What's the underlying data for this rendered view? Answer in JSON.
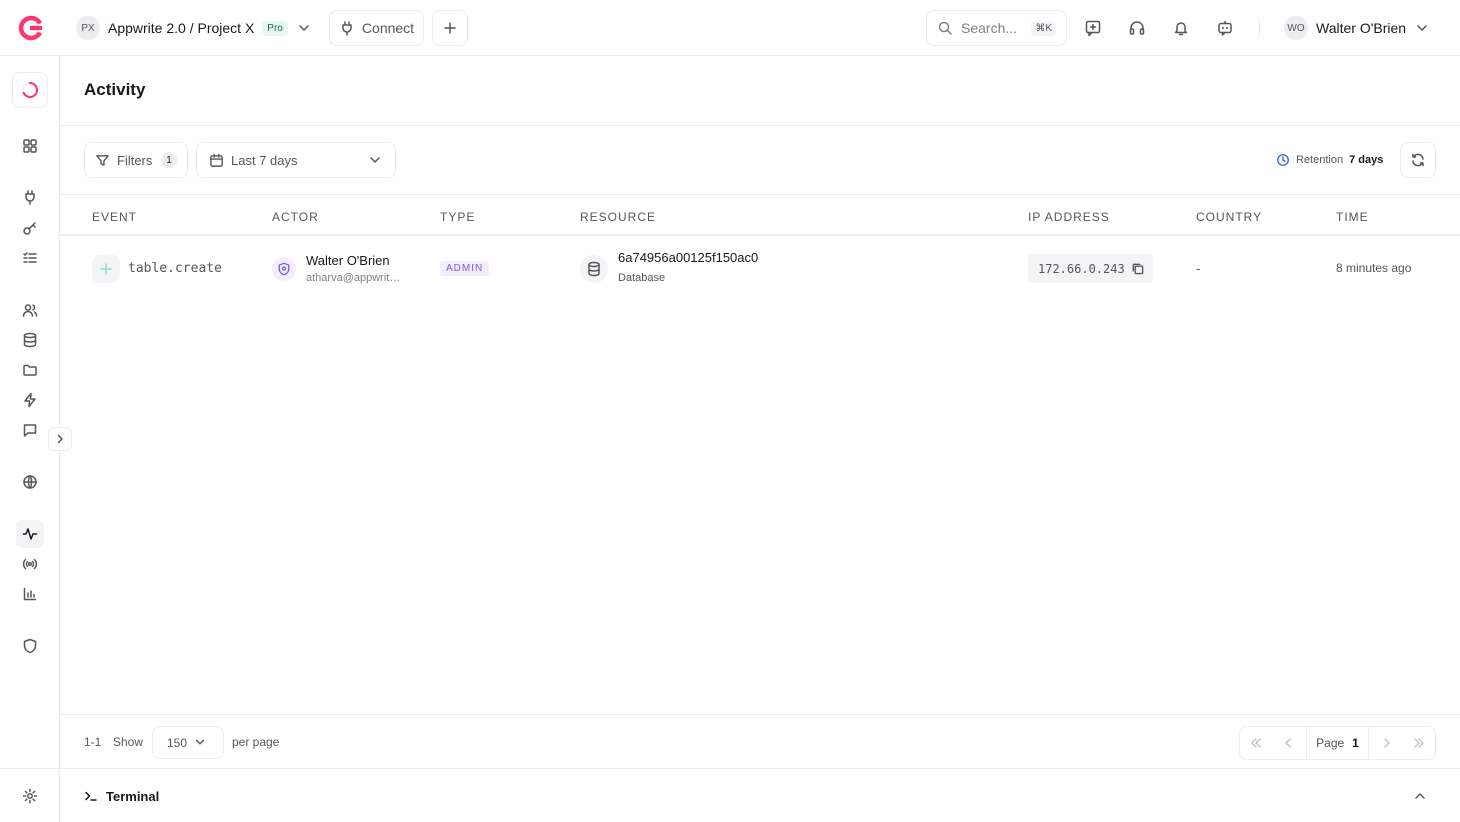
{
  "topbar": {
    "project_initials": "PX",
    "project_name": "Appwrite 2.0 / Project X",
    "plan_badge": "Pro",
    "connect_label": "Connect",
    "search_placeholder": "Search...",
    "search_shortcut": "⌘K",
    "user_initials": "WO",
    "user_name": "Walter O'Brien"
  },
  "page": {
    "title": "Activity"
  },
  "toolbar": {
    "filters_label": "Filters",
    "filters_count": "1",
    "date_range": "Last 7 days",
    "retention_label": "Retention",
    "retention_value": "7 days"
  },
  "table": {
    "columns": [
      "EVENT",
      "ACTOR",
      "TYPE",
      "RESOURCE",
      "IP ADDRESS",
      "COUNTRY",
      "TIME"
    ],
    "rows": [
      {
        "event": "table.create",
        "actor_name": "Walter O'Brien",
        "actor_email": "atharva@appwrite.io",
        "type": "ADMIN",
        "resource_id": "6a74956a00125f150ac0",
        "resource_kind": "Database",
        "ip": "172.66.0.243",
        "country": "-",
        "time": "8 minutes ago"
      }
    ]
  },
  "pagination": {
    "range": "1-1",
    "show_label": "Show",
    "per_page": "150",
    "per_page_label": "per page",
    "page_label": "Page",
    "page": "1"
  },
  "terminal": {
    "label": "Terminal"
  },
  "colors": {
    "brand": "#fd366e",
    "accent_purple": "#7c5bd6",
    "retention_blue": "#2d63e0",
    "border": "#ededf0"
  }
}
